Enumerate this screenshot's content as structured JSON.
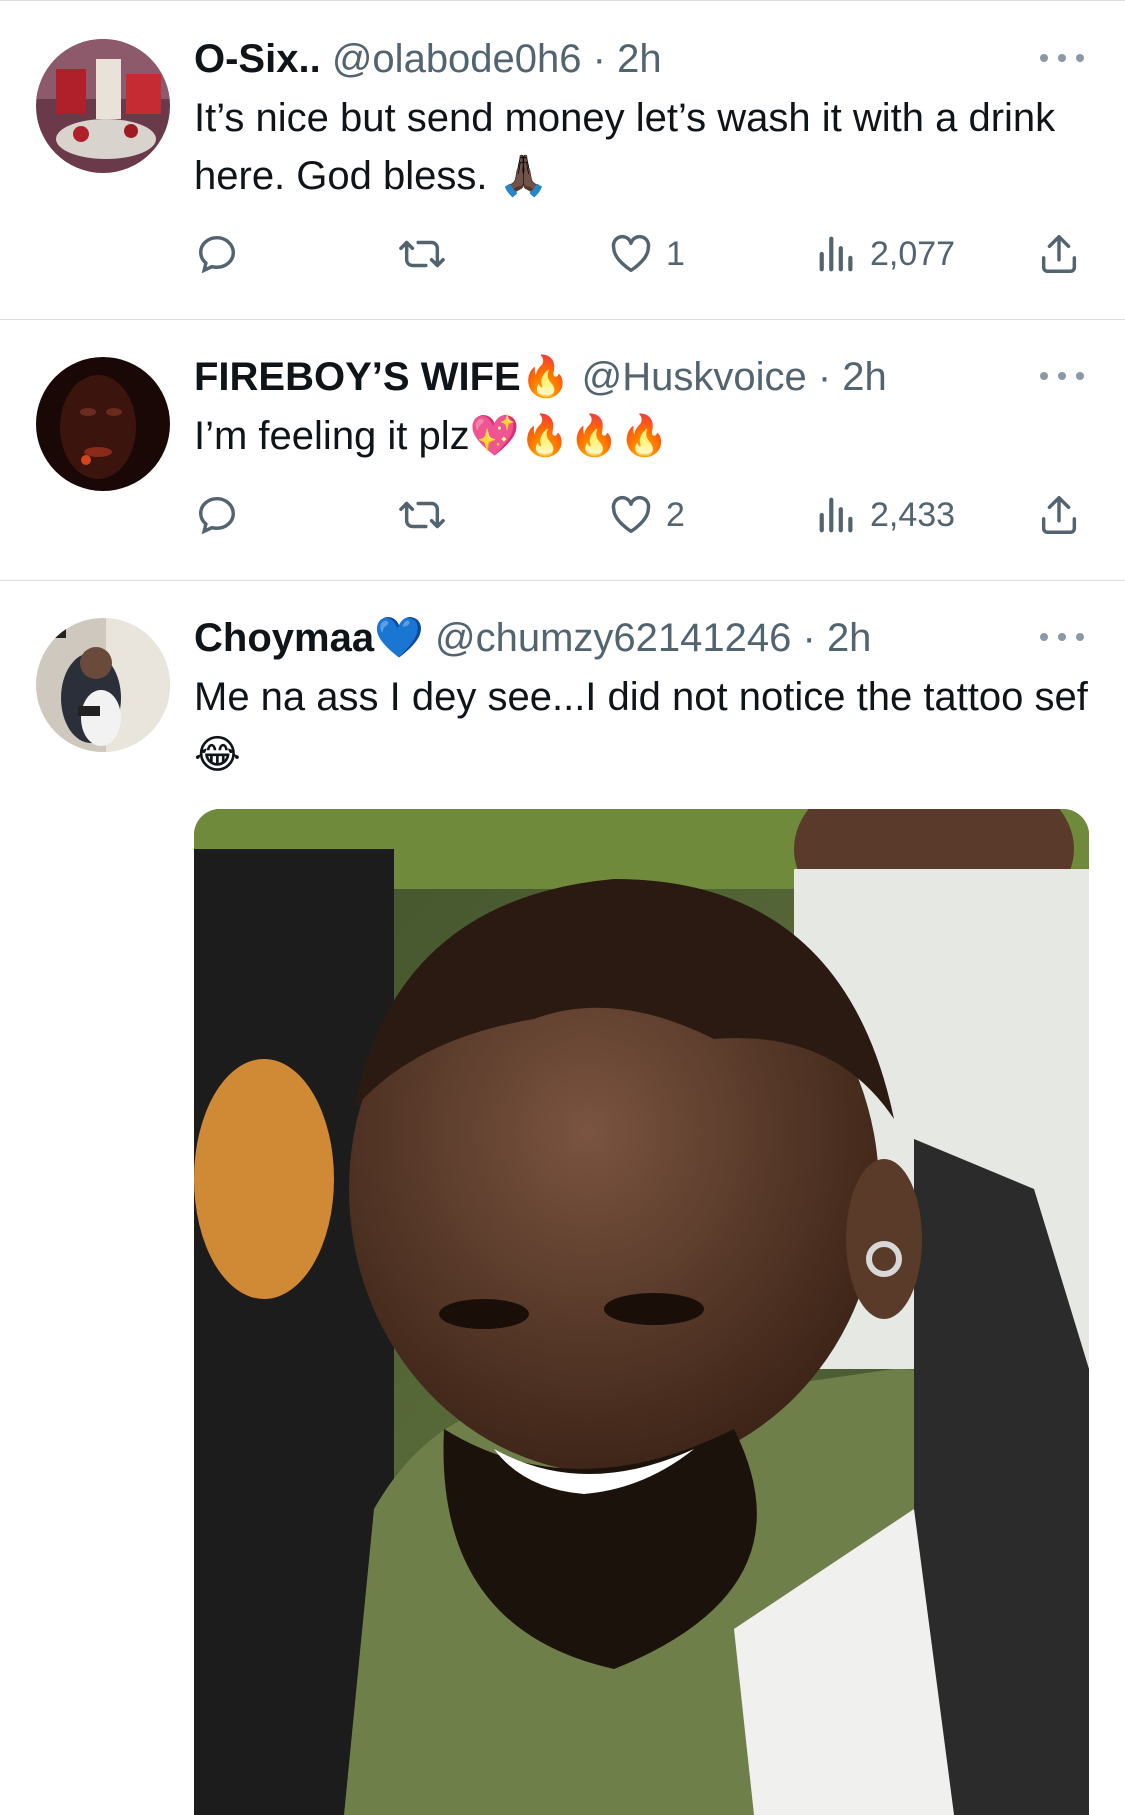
{
  "tweets": [
    {
      "name": "O-Six..",
      "handle": "@olabode0h6",
      "time": "2h",
      "text": "It’s nice but send money let’s wash it with a drink here. God bless. 🙏🏿",
      "replies": "",
      "retweets": "",
      "likes": "1",
      "views": "2,077"
    },
    {
      "name": "FIREBOY’S WIFE🔥",
      "handle": "@Huskvoice",
      "time": "2h",
      "text": "I’m feeling it plz💖🔥🔥🔥",
      "replies": "",
      "retweets": "",
      "likes": "2",
      "views": "2,433"
    },
    {
      "name": "Choymaa💙",
      "handle": "@chumzy62141246",
      "time": "2h",
      "text": "Me na ass I dey see...I did not notice the tattoo sef 😂",
      "has_media": true
    }
  ],
  "separator": " · ",
  "icons": {
    "reply": "reply-icon",
    "retweet": "retweet-icon",
    "like": "heart-icon",
    "views": "views-icon",
    "share": "share-icon",
    "more": "more-icon"
  },
  "colors": {
    "text": "#0f1419",
    "secondary": "#536471",
    "divider": "#d9dde1"
  }
}
